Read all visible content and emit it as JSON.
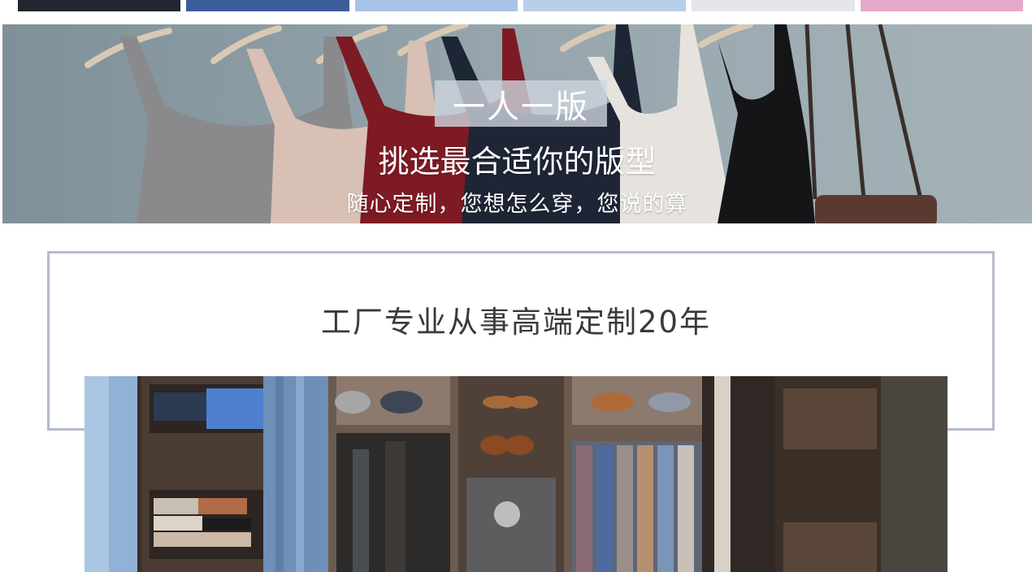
{
  "swatches": [
    {
      "color": "#22262e"
    },
    {
      "color": "#3c5d99"
    },
    {
      "color": "#a9c2e8"
    },
    {
      "color": "#b8cfe8"
    },
    {
      "color": "#e4e6ea"
    },
    {
      "color": "#e6a9c9"
    }
  ],
  "hero": {
    "tag": "一人一版",
    "title": "挑选最合适你的版型",
    "subtitle": "随心定制，您想怎么穿，您说的算"
  },
  "factory": {
    "heading": "工厂专业从事高端定制20年"
  },
  "colors": {
    "frame_border": "#b4bccb",
    "hero_bg": "#8e9ea5",
    "tag_bg": "#cdd4de",
    "heading_text": "#3a3a3a"
  }
}
